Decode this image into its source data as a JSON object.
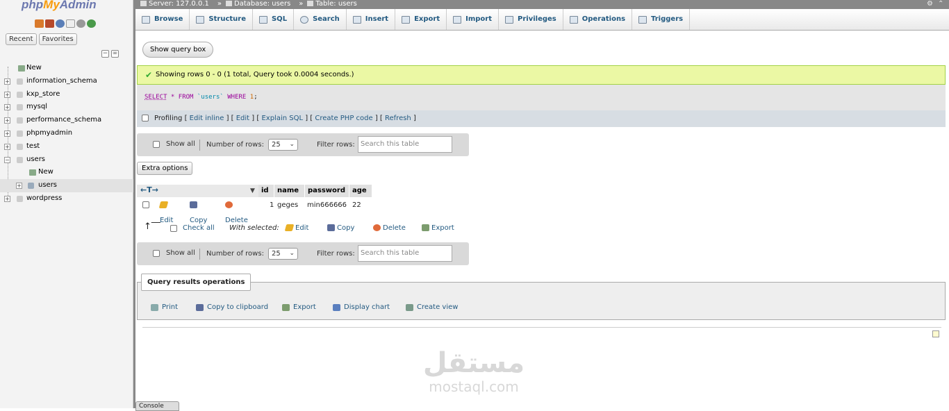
{
  "nav": {
    "logo": {
      "php": "php",
      "my": "My",
      "admin": "Admin"
    },
    "tabs": [
      "Recent",
      "Favorites"
    ],
    "icons": [
      "home-icon",
      "logout-icon",
      "help-icon",
      "docs-icon",
      "settings-icon",
      "reload-icon"
    ],
    "tree": [
      {
        "label": "New",
        "type": "new",
        "level": 0
      },
      {
        "label": "information_schema",
        "type": "db",
        "level": 0
      },
      {
        "label": "kxp_store",
        "type": "db",
        "level": 0
      },
      {
        "label": "mysql",
        "type": "db",
        "level": 0
      },
      {
        "label": "performance_schema",
        "type": "db",
        "level": 0
      },
      {
        "label": "phpmyadmin",
        "type": "db",
        "level": 0
      },
      {
        "label": "test",
        "type": "db",
        "level": 0
      },
      {
        "label": "users",
        "type": "db",
        "level": 0
      },
      {
        "label": "New",
        "type": "new",
        "level": 1
      },
      {
        "label": "users",
        "type": "table",
        "level": 1
      },
      {
        "label": "wordpress",
        "type": "db",
        "level": 0
      }
    ]
  },
  "topbar": {
    "server": "Server: 127.0.0.1",
    "database": "Database: users",
    "table": "Table: users",
    "sep": "»"
  },
  "tabs": [
    {
      "label": "Browse",
      "icon": "browse-icon"
    },
    {
      "label": "Structure",
      "icon": "structure-icon"
    },
    {
      "label": "SQL",
      "icon": "sql-icon"
    },
    {
      "label": "Search",
      "icon": "search-icon"
    },
    {
      "label": "Insert",
      "icon": "insert-icon"
    },
    {
      "label": "Export",
      "icon": "export-icon"
    },
    {
      "label": "Import",
      "icon": "import-icon"
    },
    {
      "label": "Privileges",
      "icon": "privileges-icon"
    },
    {
      "label": "Operations",
      "icon": "operations-icon"
    },
    {
      "label": "Triggers",
      "icon": "triggers-icon"
    }
  ],
  "main": {
    "show_query_box": "Show query box",
    "success_message": "Showing rows 0 - 0 (1 total, Query took 0.0004 seconds.)",
    "sql": {
      "select": "SELECT",
      "star": " * ",
      "from": "FROM",
      "table": " `users` ",
      "where": "WHERE",
      "num": " 1",
      "semi": ";"
    },
    "profiling": {
      "label": "Profiling",
      "links": [
        "Edit inline",
        "Edit",
        "Explain SQL",
        "Create PHP code",
        "Refresh"
      ]
    },
    "navbar": {
      "show_all": "Show all",
      "rows_label": "Number of rows:",
      "rows_value": "25",
      "filter_label": "Filter rows:",
      "filter_placeholder": "Search this table"
    },
    "extra_options": "Extra options",
    "columns": [
      "id",
      "name",
      "password",
      "age"
    ],
    "rows": [
      {
        "id": "1",
        "name": "geges",
        "password": "min666666",
        "age": "22"
      }
    ],
    "row_actions": {
      "edit": "Edit",
      "copy": "Copy",
      "delete": "Delete"
    },
    "bulk": {
      "check_all": "Check all",
      "with_selected": "With selected:",
      "edit": "Edit",
      "copy": "Copy",
      "delete": "Delete",
      "export": "Export"
    },
    "qro": {
      "legend": "Query results operations",
      "buttons": [
        "Print",
        "Copy to clipboard",
        "Export",
        "Display chart",
        "Create view"
      ]
    },
    "console": "Console"
  },
  "watermark": {
    "arabic": "مستقل",
    "latin": "mostaql.com"
  }
}
